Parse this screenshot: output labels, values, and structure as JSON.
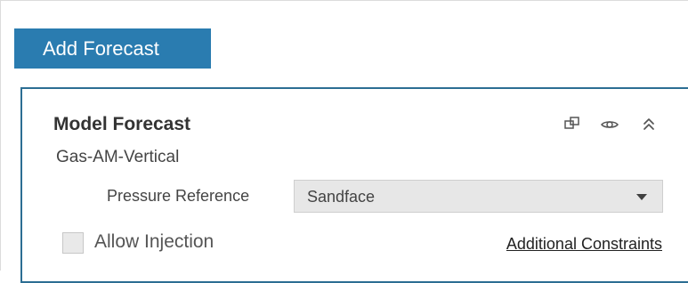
{
  "header": {
    "add_forecast_label": "Add Forecast"
  },
  "card": {
    "title": "Model Forecast",
    "subtitle": "Gas-AM-Vertical",
    "actions": [
      {
        "icon": "copy-icon"
      },
      {
        "icon": "eye-icon"
      },
      {
        "icon": "collapse-icon"
      }
    ]
  },
  "pressure_reference": {
    "label": "Pressure Reference",
    "value": "Sandface"
  },
  "allow_injection": {
    "label": "Allow Injection",
    "checked": false
  },
  "links": {
    "additional_constraints": "Additional Constraints"
  },
  "colors": {
    "button_bg": "#2a7cb0",
    "card_border": "#2c6e93",
    "dropdown_bg": "#e7e7e7"
  }
}
